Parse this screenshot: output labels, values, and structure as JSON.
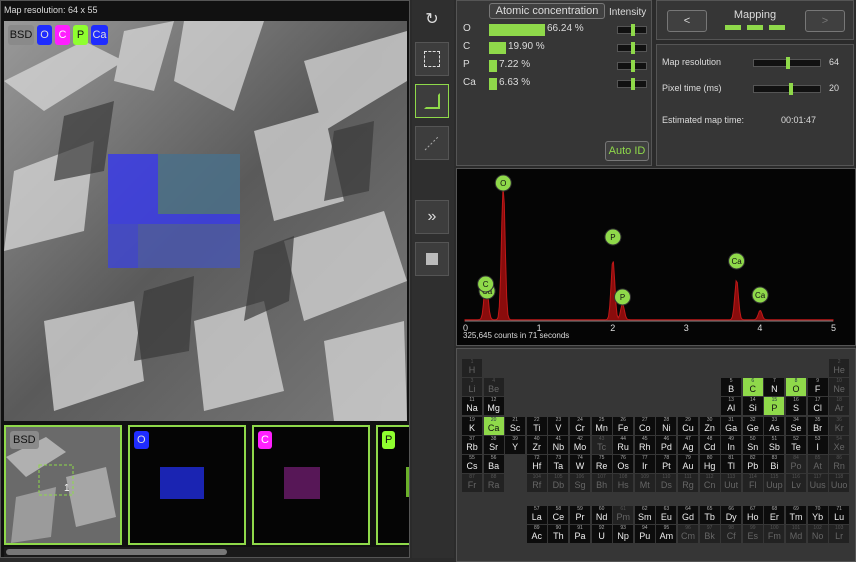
{
  "viewer": {
    "map_resolution": "Map resolution: 64 x 55",
    "badges": [
      {
        "label": "BSD",
        "bg": "#8a8a8a",
        "fg": "#111"
      },
      {
        "label": "O",
        "bg": "#1f2cff",
        "fg": "#ddd"
      },
      {
        "label": "C",
        "bg": "#ff1fff",
        "fg": "#fff"
      },
      {
        "label": "P",
        "bg": "#8fff2f",
        "fg": "#111"
      },
      {
        "label": "Ca",
        "bg": "#1f2cff",
        "fg": "#ddd"
      }
    ],
    "thumbs": [
      {
        "label": "BSD",
        "marker": "1"
      },
      {
        "label": "O"
      },
      {
        "label": "C"
      },
      {
        "label": "P"
      }
    ],
    "scroll_position": 0.55
  },
  "tools": {
    "icons": [
      "refresh-icon",
      "select-rect-icon",
      "map-area-icon",
      "line-scan-icon",
      "fast-forward-icon",
      "stop-icon"
    ]
  },
  "concentration": {
    "header": "Atomic concentration",
    "intensity_header": "Intensity",
    "rows": [
      {
        "el": "O",
        "value": "66.24 %",
        "frac": 0.6624,
        "intensity": 0.5
      },
      {
        "el": "C",
        "value": "19.90 %",
        "frac": 0.199,
        "intensity": 0.5
      },
      {
        "el": "P",
        "value": "7.22 %",
        "frac": 0.0722,
        "intensity": 0.5
      },
      {
        "el": "Ca",
        "value": "6.63 %",
        "frac": 0.0663,
        "intensity": 0.5
      }
    ],
    "auto_id": "Auto ID"
  },
  "mapping": {
    "title": "Mapping",
    "prev": "<",
    "next": ">",
    "active_color": "#8fd94a"
  },
  "settings": {
    "rows": [
      {
        "label": "Map resolution",
        "value": "64",
        "level": 0.5
      },
      {
        "label": "Pixel time (ms)",
        "value": "20",
        "level": 0.55
      }
    ],
    "estimated_label": "Estimated map time:",
    "estimated_value": "00:01:47"
  },
  "spectrum": {
    "counts": "325,645 counts in 71 seconds",
    "ticks": [
      "0",
      "1",
      "2",
      "3",
      "4",
      "5"
    ],
    "peak_labels": [
      "O",
      "P",
      "P",
      "Ca",
      "Ca",
      "Ca",
      "C"
    ],
    "chart_data": {
      "type": "area",
      "x_range": [
        0,
        5
      ],
      "peaks": [
        {
          "label": "C",
          "x": 0.28
        },
        {
          "label": "Ca",
          "x": 0.3
        },
        {
          "label": "O",
          "x": 0.52
        },
        {
          "label": "P",
          "x": 2.01
        },
        {
          "label": "P",
          "x": 2.14
        },
        {
          "label": "Ca",
          "x": 3.69
        },
        {
          "label": "Ca",
          "x": 4.01
        }
      ]
    }
  },
  "periodic": {
    "selected": [
      "C",
      "O",
      "P",
      "Ca"
    ],
    "elements": [
      [
        "H",
        1,
        1,
        1
      ],
      [
        "He",
        2,
        18,
        1
      ],
      [
        "Li",
        3,
        1,
        2
      ],
      [
        "Be",
        4,
        2,
        2
      ],
      [
        "B",
        5,
        13,
        2
      ],
      [
        "C",
        6,
        14,
        2
      ],
      [
        "N",
        7,
        15,
        2
      ],
      [
        "O",
        8,
        16,
        2
      ],
      [
        "F",
        9,
        17,
        2
      ],
      [
        "Ne",
        10,
        18,
        2
      ],
      [
        "Na",
        11,
        1,
        3
      ],
      [
        "Mg",
        12,
        2,
        3
      ],
      [
        "Al",
        13,
        13,
        3
      ],
      [
        "Si",
        14,
        14,
        3
      ],
      [
        "P",
        15,
        15,
        3
      ],
      [
        "S",
        16,
        16,
        3
      ],
      [
        "Cl",
        17,
        17,
        3
      ],
      [
        "Ar",
        18,
        18,
        3
      ],
      [
        "K",
        19,
        1,
        4
      ],
      [
        "Ca",
        20,
        2,
        4
      ],
      [
        "Sc",
        21,
        3,
        4
      ],
      [
        "Ti",
        22,
        4,
        4
      ],
      [
        "V",
        23,
        5,
        4
      ],
      [
        "Cr",
        24,
        6,
        4
      ],
      [
        "Mn",
        25,
        7,
        4
      ],
      [
        "Fe",
        26,
        8,
        4
      ],
      [
        "Co",
        27,
        9,
        4
      ],
      [
        "Ni",
        28,
        10,
        4
      ],
      [
        "Cu",
        29,
        11,
        4
      ],
      [
        "Zn",
        30,
        12,
        4
      ],
      [
        "Ga",
        31,
        13,
        4
      ],
      [
        "Ge",
        32,
        14,
        4
      ],
      [
        "As",
        33,
        15,
        4
      ],
      [
        "Se",
        34,
        16,
        4
      ],
      [
        "Br",
        35,
        17,
        4
      ],
      [
        "Kr",
        36,
        18,
        4
      ],
      [
        "Rb",
        37,
        1,
        5
      ],
      [
        "Sr",
        38,
        2,
        5
      ],
      [
        "Y",
        39,
        3,
        5
      ],
      [
        "Zr",
        40,
        4,
        5
      ],
      [
        "Nb",
        41,
        5,
        5
      ],
      [
        "Mo",
        42,
        6,
        5
      ],
      [
        "Tc",
        43,
        7,
        5
      ],
      [
        "Ru",
        44,
        8,
        5
      ],
      [
        "Rh",
        45,
        9,
        5
      ],
      [
        "Pd",
        46,
        10,
        5
      ],
      [
        "Ag",
        47,
        11,
        5
      ],
      [
        "Cd",
        48,
        12,
        5
      ],
      [
        "In",
        49,
        13,
        5
      ],
      [
        "Sn",
        50,
        14,
        5
      ],
      [
        "Sb",
        51,
        15,
        5
      ],
      [
        "Te",
        52,
        16,
        5
      ],
      [
        "I",
        53,
        17,
        5
      ],
      [
        "Xe",
        54,
        18,
        5
      ],
      [
        "Cs",
        55,
        1,
        6
      ],
      [
        "Ba",
        56,
        2,
        6
      ],
      [
        "Hf",
        72,
        4,
        6
      ],
      [
        "Ta",
        73,
        5,
        6
      ],
      [
        "W",
        74,
        6,
        6
      ],
      [
        "Re",
        75,
        7,
        6
      ],
      [
        "Os",
        76,
        8,
        6
      ],
      [
        "Ir",
        77,
        9,
        6
      ],
      [
        "Pt",
        78,
        10,
        6
      ],
      [
        "Au",
        79,
        11,
        6
      ],
      [
        "Hg",
        80,
        12,
        6
      ],
      [
        "Tl",
        81,
        13,
        6
      ],
      [
        "Pb",
        82,
        14,
        6
      ],
      [
        "Bi",
        83,
        15,
        6
      ],
      [
        "Po",
        84,
        16,
        6
      ],
      [
        "At",
        85,
        17,
        6
      ],
      [
        "Rn",
        86,
        18,
        6
      ],
      [
        "Fr",
        87,
        1,
        7
      ],
      [
        "Ra",
        88,
        2,
        7
      ],
      [
        "Rf",
        104,
        4,
        7
      ],
      [
        "Db",
        105,
        5,
        7
      ],
      [
        "Sg",
        106,
        6,
        7
      ],
      [
        "Bh",
        107,
        7,
        7
      ],
      [
        "Hs",
        108,
        8,
        7
      ],
      [
        "Mt",
        109,
        9,
        7
      ],
      [
        "Ds",
        110,
        10,
        7
      ],
      [
        "Rg",
        111,
        11,
        7
      ],
      [
        "Cn",
        112,
        12,
        7
      ],
      [
        "Uut",
        113,
        13,
        7
      ],
      [
        "Fl",
        114,
        14,
        7
      ],
      [
        "Uup",
        115,
        15,
        7
      ],
      [
        "Lv",
        116,
        16,
        7
      ],
      [
        "Uus",
        117,
        17,
        7
      ],
      [
        "Uuo",
        118,
        18,
        7
      ],
      [
        "La",
        57,
        4,
        9
      ],
      [
        "Ce",
        58,
        5,
        9
      ],
      [
        "Pr",
        59,
        6,
        9
      ],
      [
        "Nd",
        60,
        7,
        9
      ],
      [
        "Pm",
        61,
        8,
        9
      ],
      [
        "Sm",
        62,
        9,
        9
      ],
      [
        "Eu",
        63,
        10,
        9
      ],
      [
        "Gd",
        64,
        11,
        9
      ],
      [
        "Tb",
        65,
        12,
        9
      ],
      [
        "Dy",
        66,
        13,
        9
      ],
      [
        "Ho",
        67,
        14,
        9
      ],
      [
        "Er",
        68,
        15,
        9
      ],
      [
        "Tm",
        69,
        16,
        9
      ],
      [
        "Yb",
        70,
        17,
        9
      ],
      [
        "Lu",
        71,
        18,
        9
      ],
      [
        "Ac",
        89,
        4,
        10
      ],
      [
        "Th",
        90,
        5,
        10
      ],
      [
        "Pa",
        91,
        6,
        10
      ],
      [
        "U",
        92,
        7,
        10
      ],
      [
        "Np",
        93,
        8,
        10
      ],
      [
        "Pu",
        94,
        9,
        10
      ],
      [
        "Am",
        95,
        10,
        10
      ],
      [
        "Cm",
        96,
        11,
        10
      ],
      [
        "Bk",
        97,
        12,
        10
      ],
      [
        "Cf",
        98,
        13,
        10
      ],
      [
        "Es",
        99,
        14,
        10
      ],
      [
        "Fm",
        100,
        15,
        10
      ],
      [
        "Md",
        101,
        16,
        10
      ],
      [
        "No",
        102,
        17,
        10
      ],
      [
        "Lr",
        103,
        18,
        10
      ]
    ],
    "dimmed": [
      "H",
      "He",
      "Li",
      "Be",
      "Ne",
      "Ar",
      "Kr",
      "Xe",
      "Rn",
      "Tc",
      "Pm",
      "Po",
      "At",
      "Fr",
      "Ra",
      "Rf",
      "Db",
      "Sg",
      "Bh",
      "Hs",
      "Mt",
      "Ds",
      "Rg",
      "Cn",
      "Uut",
      "Fl",
      "Uup",
      "Lv",
      "Uus",
      "Uuo",
      "Cm",
      "Bk",
      "Cf",
      "Es",
      "Fm",
      "Md",
      "No",
      "Lr"
    ]
  }
}
